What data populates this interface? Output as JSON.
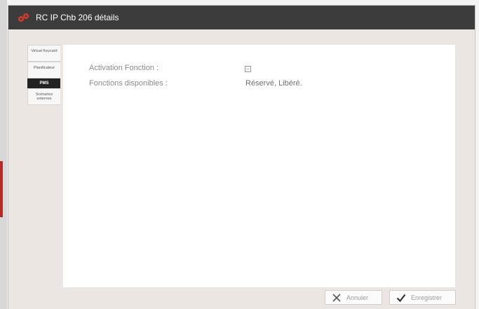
{
  "window": {
    "title": "RC IP Chb 206 détails",
    "icon": "app-logo-icon",
    "title_bar_color": "#3c3c3c",
    "accent_color": "#d63a2f"
  },
  "tabs": [
    {
      "label": "Virtual Keycard",
      "active": false
    },
    {
      "label": "Planificateur",
      "active": false
    },
    {
      "label": "PMS",
      "active": true
    },
    {
      "label": "Scénarios externes",
      "active": false
    }
  ],
  "form": {
    "activation_label": "Activation Fonction :",
    "activation_checked": false,
    "functions_label": "Fonctions disponibles :",
    "functions_value": "Réservé, Libéré."
  },
  "footer": {
    "cancel_label": "Annuler",
    "cancel_icon": "close-icon",
    "save_label": "Enregistrer",
    "save_icon": "checkmark-icon"
  }
}
